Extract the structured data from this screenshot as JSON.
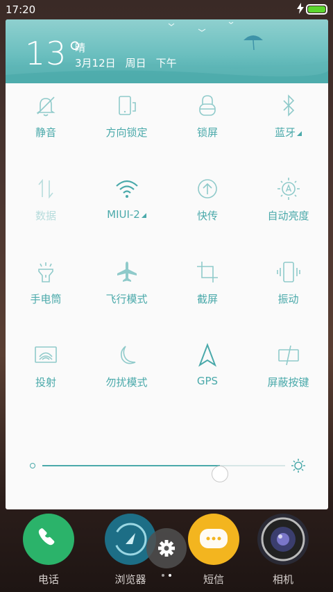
{
  "status_bar": {
    "time": "17:20",
    "charging_icon": "lightning-bolt-icon",
    "battery_level": 1.0,
    "battery_color": "#5cd62e"
  },
  "weather": {
    "temperature": "13°",
    "condition": "晴",
    "date": "3月12日",
    "weekday": "周日",
    "period": "下午"
  },
  "accent_color": "#4aa9aa",
  "toggles": [
    {
      "label": "静音",
      "icon": "bell-off-icon",
      "active": false
    },
    {
      "label": "方向锁定",
      "icon": "rotation-lock-icon",
      "active": false
    },
    {
      "label": "锁屏",
      "icon": "lock-icon",
      "active": false
    },
    {
      "label": "蓝牙",
      "icon": "bluetooth-icon",
      "active": false,
      "has_more": true
    },
    {
      "label": "数据",
      "icon": "mobile-data-icon",
      "active": false,
      "disabled": true
    },
    {
      "label": "MIUI-2",
      "icon": "wifi-icon",
      "active": true,
      "has_more": true
    },
    {
      "label": "快传",
      "icon": "quick-transfer-icon",
      "active": false
    },
    {
      "label": "自动亮度",
      "icon": "auto-brightness-icon",
      "active": false
    },
    {
      "label": "手电筒",
      "icon": "flashlight-icon",
      "active": false
    },
    {
      "label": "飞行模式",
      "icon": "airplane-icon",
      "active": false
    },
    {
      "label": "截屏",
      "icon": "screenshot-crop-icon",
      "active": false
    },
    {
      "label": "振动",
      "icon": "vibrate-icon",
      "active": false
    },
    {
      "label": "投射",
      "icon": "cast-icon",
      "active": false
    },
    {
      "label": "勿扰模式",
      "icon": "moon-icon",
      "active": false
    },
    {
      "label": "GPS",
      "icon": "gps-arrow-icon",
      "active": true
    },
    {
      "label": "屏蔽按键",
      "icon": "block-keys-icon",
      "active": false
    }
  ],
  "brightness": {
    "level": 0.73
  },
  "dock": [
    {
      "label": "电话",
      "icon": "phone-icon",
      "color": "#2bb36a"
    },
    {
      "label": "浏览器",
      "icon": "compass-icon",
      "color": "#1d6e86"
    },
    {
      "label": "短信",
      "icon": "message-icon",
      "color": "#f3b51f"
    },
    {
      "label": "相机",
      "icon": "camera-icon",
      "color": "#2a2a35"
    }
  ],
  "settings_button": {
    "icon": "gear-icon"
  }
}
